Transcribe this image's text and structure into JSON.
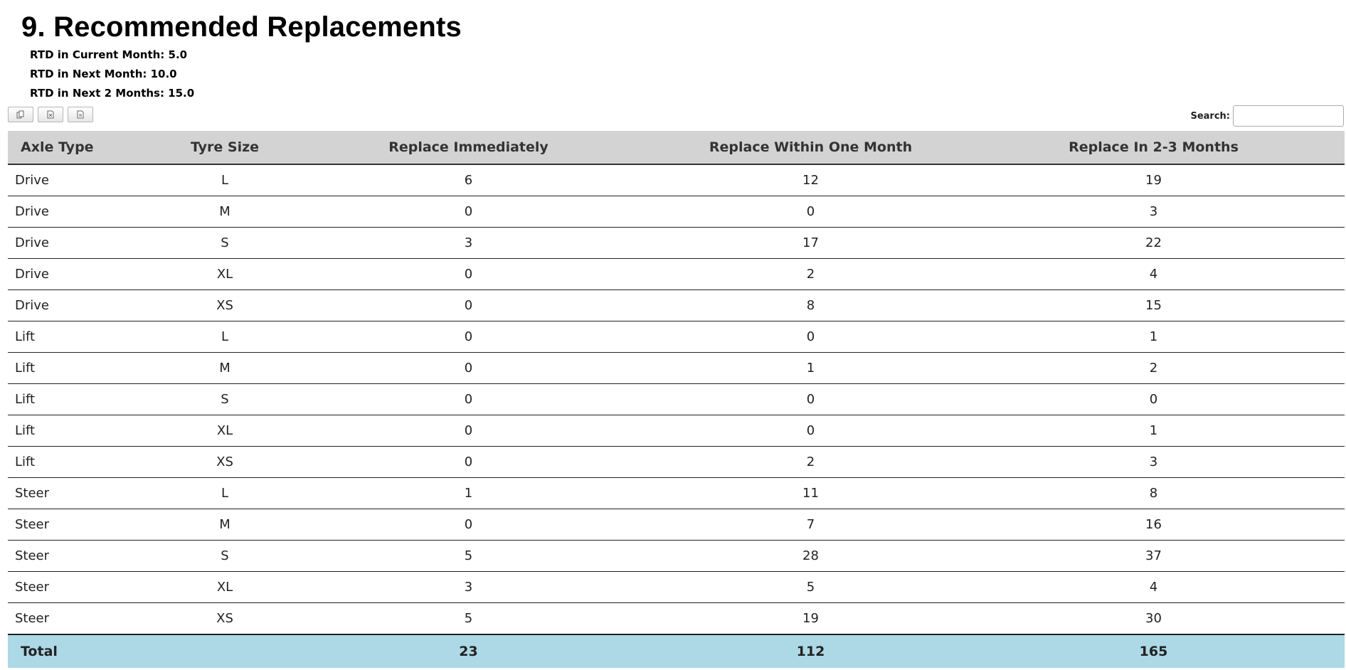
{
  "page": {
    "title": "9.  Recommended Replacements"
  },
  "rtd": [
    {
      "text": "RTD in Current Month: 5.0"
    },
    {
      "text": "RTD in Next Month: 10.0"
    },
    {
      "text": "RTD in Next 2 Months: 15.0"
    }
  ],
  "export_buttons": [
    {
      "icon": "copy-icon"
    },
    {
      "icon": "excel-icon"
    },
    {
      "icon": "pdf-icon"
    }
  ],
  "search": {
    "label": "Search:",
    "value": ""
  },
  "table": {
    "headers": [
      "Axle Type",
      "Tyre Size",
      "Replace Immediately",
      "Replace Within One Month",
      "Replace In 2-3 Months"
    ],
    "rows": [
      [
        "Drive",
        "L",
        "6",
        "12",
        "19"
      ],
      [
        "Drive",
        "M",
        "0",
        "0",
        "3"
      ],
      [
        "Drive",
        "S",
        "3",
        "17",
        "22"
      ],
      [
        "Drive",
        "XL",
        "0",
        "2",
        "4"
      ],
      [
        "Drive",
        "XS",
        "0",
        "8",
        "15"
      ],
      [
        "Lift",
        "L",
        "0",
        "0",
        "1"
      ],
      [
        "Lift",
        "M",
        "0",
        "1",
        "2"
      ],
      [
        "Lift",
        "S",
        "0",
        "0",
        "0"
      ],
      [
        "Lift",
        "XL",
        "0",
        "0",
        "1"
      ],
      [
        "Lift",
        "XS",
        "0",
        "2",
        "3"
      ],
      [
        "Steer",
        "L",
        "1",
        "11",
        "8"
      ],
      [
        "Steer",
        "M",
        "0",
        "7",
        "16"
      ],
      [
        "Steer",
        "S",
        "5",
        "28",
        "37"
      ],
      [
        "Steer",
        "XL",
        "3",
        "5",
        "4"
      ],
      [
        "Steer",
        "XS",
        "5",
        "19",
        "30"
      ]
    ],
    "footer": [
      "Total",
      "",
      "23",
      "112",
      "165"
    ]
  },
  "colors": {
    "header_bg": "#d3d3d3",
    "footer_bg": "#add8e6"
  }
}
